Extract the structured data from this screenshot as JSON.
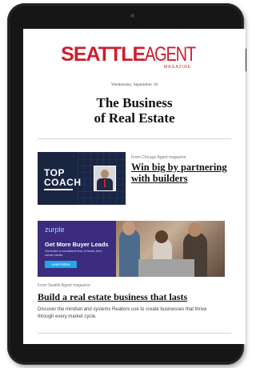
{
  "masthead": {
    "name_part1": "SEATTLE",
    "name_part2": "AGENT",
    "subtitle": "MAGAZINE"
  },
  "issue": {
    "date": "Wednesday, September 18"
  },
  "newsletter": {
    "headline_line1": "The Business",
    "headline_line2": "of Real Estate"
  },
  "featured": {
    "image_label_line1": "TOP",
    "image_label_line2": "COACH",
    "source": "From Chicago Agent magazine",
    "title": "Win big by partnering with builders"
  },
  "ad": {
    "brand": "zurple",
    "headline": "Get More Buyer Leads",
    "subtext": "Generate a consistent flow of leads from social media",
    "button_label": "Learn More"
  },
  "article": {
    "source": "From Seattle Agent magazine",
    "title": "Build a real estate business that lasts",
    "summary": "Discover the mindset and systems Realtors use to create businesses that thrive through every market cycle."
  },
  "colors": {
    "brand": "#cf1d2d",
    "ad_bg": "#3b2c7e",
    "ad_button": "#1fa9e8",
    "device": "#161616"
  }
}
